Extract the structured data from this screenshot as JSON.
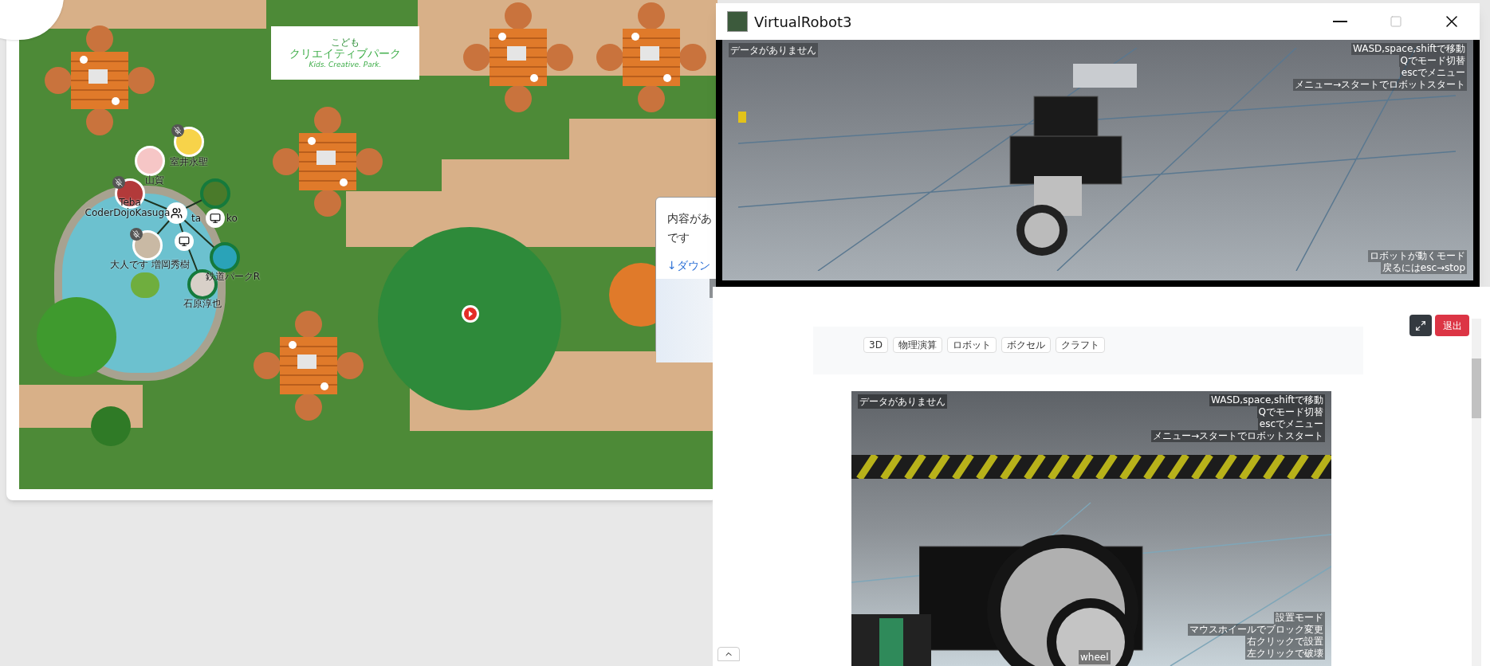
{
  "map": {
    "logo": {
      "line_1": "こども",
      "line_2": "クリエイティブパーク",
      "tagline": "Kids. Creative. Park."
    },
    "avatars": [
      {
        "name": "室井永聖",
        "muted": true,
        "highlighted": false
      },
      {
        "name": "山賀",
        "muted": false,
        "highlighted": false
      },
      {
        "name": "Teba",
        "org": "CoderDojoKasuga",
        "muted": true,
        "highlighted": false
      },
      {
        "name": "ta",
        "muted": false,
        "highlighted": true
      },
      {
        "name": "大人です 増岡秀樹",
        "muted": true,
        "highlighted": false
      },
      {
        "name": "鉄道パークR",
        "muted": false,
        "highlighted": true
      },
      {
        "name": "石原淳也",
        "muted": false,
        "highlighted": true
      }
    ],
    "hidden_label_tail": "ko",
    "popup": {
      "lines": [
        "内容があ",
        "です"
      ],
      "link": "↓ダウン"
    }
  },
  "robot_window": {
    "title": "VirtualRobot3",
    "status": "データがありません",
    "help_lines": [
      "WASD,space,shiftで移動",
      "Qでモード切替",
      "escでメニュー",
      "メニュー→スタートでロボットスタート"
    ],
    "mode_lines": [
      "ロボットが動くモード",
      "戻るにはesc→stop"
    ]
  },
  "panel": {
    "tags": [
      "3D",
      "物理演算",
      "ロボット",
      "ボクセル",
      "クラフト"
    ],
    "exit_button": "退出",
    "game_view": {
      "status": "データがありません",
      "help_lines": [
        "WASD,space,shiftで移動",
        "Qでモード切替",
        "escでメニュー",
        "メニュー→スタートでロボットスタート"
      ],
      "mode_lines": [
        "設置モード",
        "マウスホイールでブロック変更",
        "右クリックで設置",
        "左クリックで破壊"
      ],
      "block_name": "wheel"
    }
  }
}
